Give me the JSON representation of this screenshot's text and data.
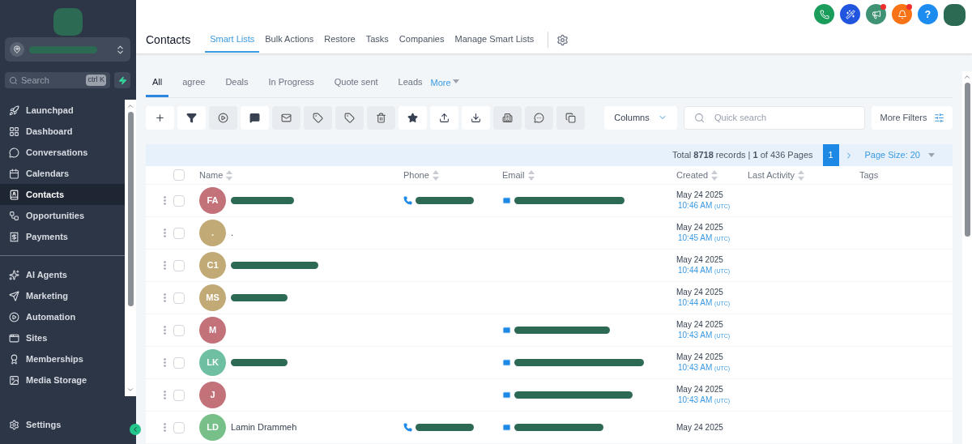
{
  "sidebar": {
    "search": {
      "placeholder": "Search",
      "shortcut": "ctrl K"
    },
    "groups": [
      {
        "items": [
          {
            "label": "Launchpad",
            "selected": false
          },
          {
            "label": "Dashboard",
            "selected": false
          },
          {
            "label": "Conversations",
            "selected": false
          },
          {
            "label": "Calendars",
            "selected": false
          },
          {
            "label": "Contacts",
            "selected": true
          },
          {
            "label": "Opportunities",
            "selected": false
          },
          {
            "label": "Payments",
            "selected": false
          }
        ]
      },
      {
        "items": [
          {
            "label": "AI Agents",
            "selected": false
          },
          {
            "label": "Marketing",
            "selected": false
          },
          {
            "label": "Automation",
            "selected": false
          },
          {
            "label": "Sites",
            "selected": false
          },
          {
            "label": "Memberships",
            "selected": false
          },
          {
            "label": "Media Storage",
            "selected": false
          }
        ]
      }
    ],
    "settings": "Settings"
  },
  "header": {
    "title": "Contacts",
    "tabs": [
      {
        "label": "Smart Lists",
        "selected": true
      },
      {
        "label": "Bulk Actions",
        "selected": false
      },
      {
        "label": "Restore",
        "selected": false
      },
      {
        "label": "Tasks",
        "selected": false
      },
      {
        "label": "Companies",
        "selected": false
      },
      {
        "label": "Manage Smart Lists",
        "selected": false
      }
    ],
    "quick_actions": [
      {
        "color": "#1a9c5b",
        "badge": false
      },
      {
        "color": "#2155e0",
        "badge": false
      },
      {
        "color": "#3f9374",
        "badge": true
      },
      {
        "color": "#f97316",
        "badge": true
      },
      {
        "color": "#1d8cf0",
        "badge": false
      }
    ],
    "help": "?"
  },
  "smart_lists": {
    "tabs": [
      {
        "label": "All",
        "selected": true
      },
      {
        "label": "agree",
        "selected": false
      },
      {
        "label": "Deals",
        "selected": false
      },
      {
        "label": "In Progress",
        "selected": false
      },
      {
        "label": "Quote sent",
        "selected": false
      },
      {
        "label": "Leads",
        "selected": false
      }
    ],
    "more": "More"
  },
  "toolbar": {
    "actions": [
      {
        "disabled": false
      },
      {
        "disabled": false
      },
      {
        "disabled": true
      },
      {
        "disabled": false
      },
      {
        "disabled": true
      },
      {
        "disabled": true
      },
      {
        "disabled": true
      },
      {
        "disabled": true
      },
      {
        "disabled": false
      },
      {
        "disabled": false
      },
      {
        "disabled": false
      },
      {
        "disabled": true
      },
      {
        "disabled": true
      },
      {
        "disabled": true
      }
    ],
    "columns": "Columns",
    "search_placeholder": "Quick search",
    "more_filters": "More Filters"
  },
  "pagination": {
    "summary": "Total **8718** records | **1** of 436 Pages",
    "page": "1",
    "page_size": "Page Size: 20"
  },
  "table": {
    "select_all_checked": false,
    "columns": [
      "Name",
      "Phone",
      "Email",
      "Created",
      "Last Activity",
      "Tags"
    ],
    "rows": [
      {
        "checked": false,
        "initials": "FA",
        "color": "#c4727a",
        "name_redacted": true,
        "phone_redacted": true,
        "email_redacted": true,
        "date": "May 24 2025",
        "time": "10:46 AM",
        "tz": "(UTC)"
      },
      {
        "checked": false,
        "initials": ".",
        "color": "#c2aa76",
        "name": ".",
        "name_redacted": false,
        "phone_redacted": false,
        "email_redacted": false,
        "date": "May 24 2025",
        "time": "10:45 AM",
        "tz": "(UTC)"
      },
      {
        "checked": false,
        "initials": "C1",
        "color": "#c2aa76",
        "name_redacted": true,
        "phone_redacted": false,
        "email_redacted": false,
        "date": "May 24 2025",
        "time": "10:44 AM",
        "tz": "(UTC)"
      },
      {
        "checked": false,
        "initials": "MS",
        "color": "#c2aa76",
        "name_redacted": true,
        "phone_redacted": false,
        "email_redacted": false,
        "date": "May 24 2025",
        "time": "10:44 AM",
        "tz": "(UTC)"
      },
      {
        "checked": false,
        "initials": "M",
        "color": "#c4727a",
        "name_redacted": false,
        "phone_redacted": false,
        "email_redacted": true,
        "date": "May 24 2025",
        "time": "10:43 AM",
        "tz": "(UTC)"
      },
      {
        "checked": false,
        "initials": "LK",
        "color": "#6fbfa2",
        "name_redacted": true,
        "phone_redacted": false,
        "email_redacted": true,
        "date": "May 24 2025",
        "time": "10:43 AM",
        "tz": "(UTC)"
      },
      {
        "checked": false,
        "initials": "J",
        "color": "#c4727a",
        "name_redacted": false,
        "phone_redacted": false,
        "email_redacted": true,
        "date": "May 24 2025",
        "time": "10:43 AM",
        "tz": "(UTC)"
      },
      {
        "checked": false,
        "initials": "LD",
        "color": "#77c08a",
        "name": "Lamin Drammeh",
        "name_redacted": false,
        "phone_redacted": true,
        "email_redacted": true,
        "date": "May 24 2025"
      }
    ]
  }
}
